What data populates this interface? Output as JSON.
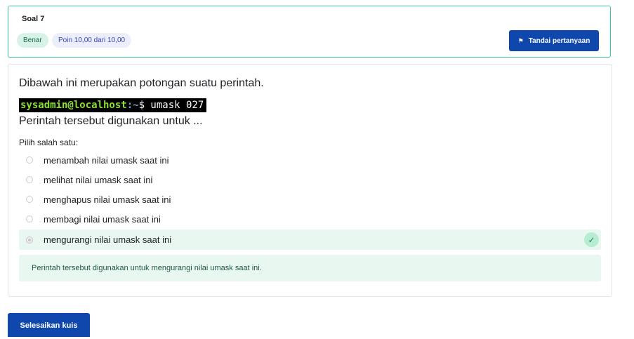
{
  "question_info": {
    "number_label": "Soal 7",
    "status_badge": "Benar",
    "grade_badge": "Poin 10,00 dari 10,00",
    "flag_button_label": "Tandai pertanyaan",
    "flag_icon": "flag-icon",
    "accent_border": "#3fc49a"
  },
  "question": {
    "text_intro": "Dibawah ini merupakan potongan suatu perintah.",
    "terminal": {
      "user_host": "sysadmin@localhost",
      "path": ":~",
      "command": "$ umask 027"
    },
    "text_question": "Perintah tersebut digunakan untuk ...",
    "prompt": "Pilih salah satu:",
    "options": [
      {
        "label": "menambah nilai umask saat ini",
        "selected": false
      },
      {
        "label": "melihat nilai umask saat ini",
        "selected": false
      },
      {
        "label": "menghapus nilai umask saat ini",
        "selected": false
      },
      {
        "label": "membagi nilai umask saat ini",
        "selected": false
      },
      {
        "label": "mengurangi nilai umask saat ini",
        "selected": true,
        "correct": true
      }
    ],
    "correct_icon": "check-icon",
    "feedback": "Perintah tersebut digunakan untuk mengurangi nilai umask saat ini."
  },
  "footer": {
    "finish_button_label": "Selesaikan kuis",
    "button_color": "#0f47ad"
  }
}
